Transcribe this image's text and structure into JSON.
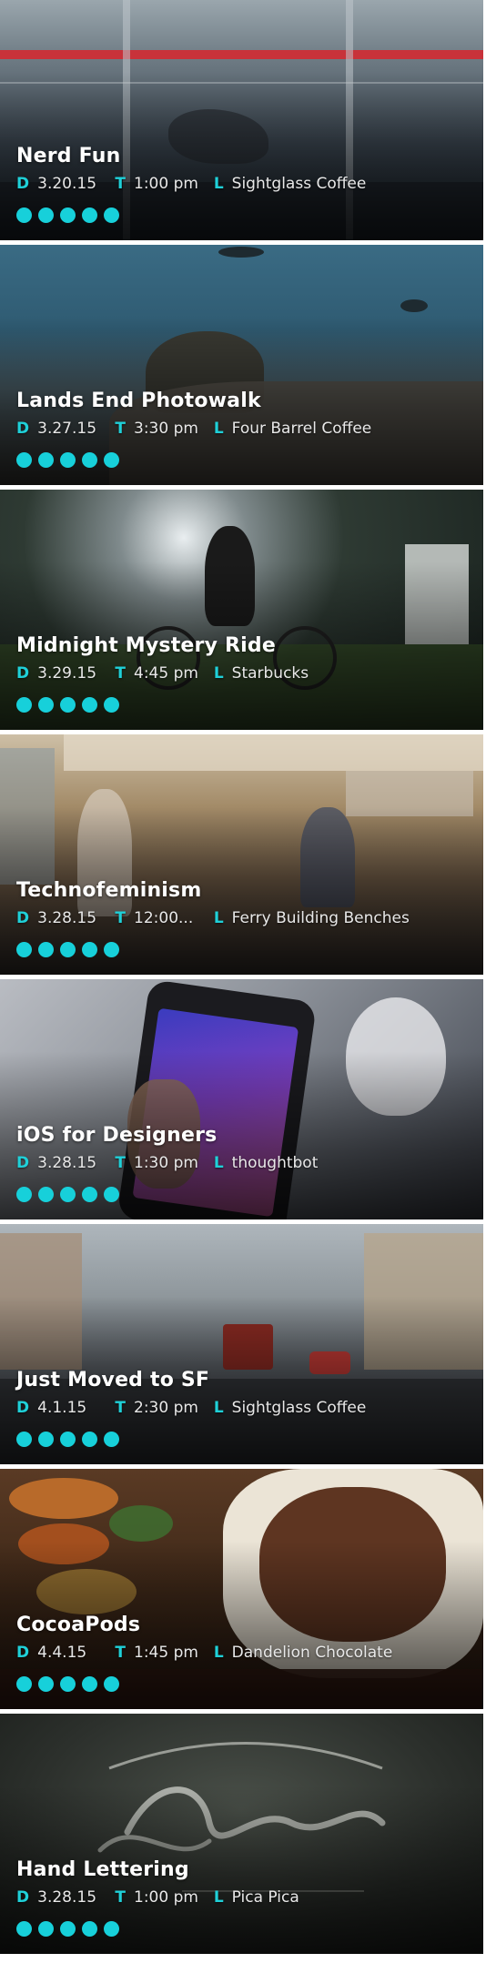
{
  "accent_color": "#17d0da",
  "meta_keys": {
    "date": "D",
    "time": "T",
    "location": "L"
  },
  "events": [
    {
      "title": "Nerd Fun",
      "date": "3.20.15",
      "time": "1:00 pm",
      "location": "Sightglass Coffee",
      "dots": 5
    },
    {
      "title": "Lands End Photowalk",
      "date": "3.27.15",
      "time": "3:30 pm",
      "location": "Four Barrel Coffee",
      "dots": 5
    },
    {
      "title": "Midnight Mystery Ride",
      "date": "3.29.15",
      "time": "4:45 pm",
      "location": "Starbucks",
      "dots": 5
    },
    {
      "title": "Technofeminism",
      "date": "3.28.15",
      "time": "12:00...",
      "location": "Ferry Building Benches",
      "dots": 5
    },
    {
      "title": "iOS for Designers",
      "date": "3.28.15",
      "time": "1:30 pm",
      "location": "thoughtbot",
      "dots": 5
    },
    {
      "title": "Just Moved to SF",
      "date": "4.1.15",
      "time": "2:30 pm",
      "location": "Sightglass Coffee",
      "dots": 5
    },
    {
      "title": "CocoaPods",
      "date": "4.4.15",
      "time": "1:45 pm",
      "location": "Dandelion Chocolate",
      "dots": 5
    },
    {
      "title": "Hand Lettering",
      "date": "3.28.15",
      "time": "1:00 pm",
      "location": "Pica Pica",
      "dots": 5
    }
  ]
}
